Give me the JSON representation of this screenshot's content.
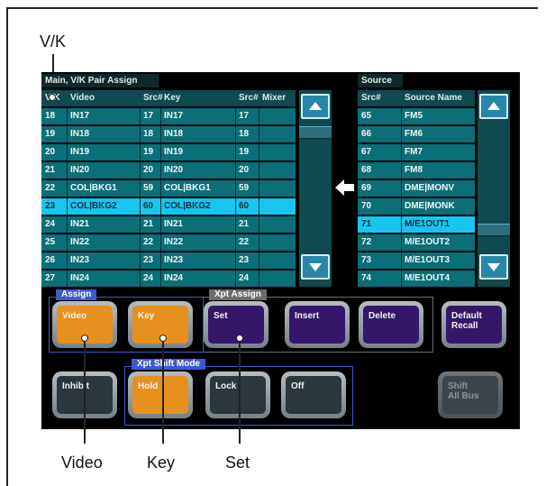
{
  "callouts": {
    "top": "V/K",
    "bottom": [
      "Video",
      "Key",
      "Set"
    ]
  },
  "left_panel": {
    "title": "Main, V/K Pair Assign",
    "columns": [
      "V/K",
      "Video",
      "Src#",
      "Key",
      "Src#",
      "Mixer"
    ],
    "rows": [
      [
        "18",
        "IN17",
        "17",
        "IN17",
        "17",
        ""
      ],
      [
        "19",
        "IN18",
        "18",
        "IN18",
        "18",
        ""
      ],
      [
        "20",
        "IN19",
        "19",
        "IN19",
        "19",
        ""
      ],
      [
        "21",
        "IN20",
        "20",
        "IN20",
        "20",
        ""
      ],
      [
        "22",
        "COL|BKG1",
        "59",
        "COL|BKG1",
        "59",
        ""
      ],
      [
        "23",
        "COL|BKG2",
        "60",
        "COL|BKG2",
        "60",
        ""
      ],
      [
        "24",
        "IN21",
        "21",
        "IN21",
        "21",
        ""
      ],
      [
        "25",
        "IN22",
        "22",
        "IN22",
        "22",
        ""
      ],
      [
        "26",
        "IN23",
        "23",
        "IN23",
        "23",
        ""
      ],
      [
        "27",
        "IN24",
        "24",
        "IN24",
        "24",
        ""
      ]
    ],
    "selected_index": 5
  },
  "right_panel": {
    "title": "Source",
    "columns": [
      "Src#",
      "Source Name"
    ],
    "rows": [
      [
        "65",
        "FM5"
      ],
      [
        "66",
        "FM6"
      ],
      [
        "67",
        "FM7"
      ],
      [
        "68",
        "FM8"
      ],
      [
        "69",
        "DME|MONV"
      ],
      [
        "70",
        "DME|MONK"
      ],
      [
        "71",
        "M/E1OUT1"
      ],
      [
        "72",
        "M/E1OUT2"
      ],
      [
        "73",
        "M/E1OUT3"
      ],
      [
        "74",
        "M/E1OUT4"
      ]
    ],
    "selected_index": 6
  },
  "groups": {
    "assign": "Assign",
    "xpt_assign": "Xpt Assign",
    "xpt_shift_mode": "Xpt Shift Mode"
  },
  "buttons": {
    "video": "Video",
    "key": "Key",
    "set": "Set",
    "insert": "Insert",
    "delete": "Delete",
    "default_recall": "Default\nRecall",
    "inhibit": "Inhibit",
    "hold": "Hold",
    "lock": "Lock",
    "off": "Off",
    "shift_all_bus": "Shift\nAll Bus"
  },
  "colors": {
    "selected_row": "#17c6ee",
    "active_button": "#e8901e",
    "xpt_button": "#35176a"
  },
  "icons": {
    "scroll_up": "triangle-up",
    "scroll_down": "triangle-down",
    "assign_arrow": "arrow-left"
  }
}
